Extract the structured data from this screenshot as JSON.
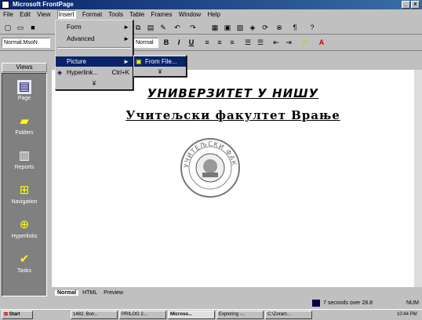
{
  "window": {
    "title": "Microsoft FrontPage"
  },
  "menu": [
    "File",
    "Edit",
    "View",
    "Insert",
    "Format",
    "Tools",
    "Table",
    "Frames",
    "Window",
    "Help"
  ],
  "toolbar2": {
    "style": "Normal.MsoN",
    "font": "Normal"
  },
  "insert_menu": {
    "items": [
      {
        "label": "Form",
        "arrow": "►"
      },
      {
        "label": "Advanced",
        "arrow": "►"
      },
      {
        "label": "Picture",
        "arrow": "►"
      },
      {
        "label": "Hyperlink...",
        "shortcut": "Ctrl+K"
      },
      {
        "label": "¥"
      }
    ]
  },
  "picture_submenu": {
    "items": [
      {
        "label": "From File..."
      },
      {
        "label": "¥"
      }
    ]
  },
  "views": {
    "title": "Views",
    "items": [
      "Page",
      "Folders",
      "Reports",
      "Navigation",
      "Hyperlinks",
      "Tasks"
    ]
  },
  "page": {
    "heading1": "УНИВЕРЗИТЕТ У НИШУ",
    "heading2": "Учитељски факултет Врање",
    "seal": "УЧИТЕЉСКИ ФАКУЛТЕТ"
  },
  "tabs": [
    "Normal",
    "HTML",
    "Preview"
  ],
  "status": {
    "time": "7 seconds over 28.8",
    "mode": "NUM"
  },
  "taskbar": {
    "start": "Start",
    "tasks": [
      "1482. Bon...",
      "PRILOG 2...",
      "Microso...",
      "Exploring -...",
      "C:\\Zoran\\..."
    ],
    "clock": "10:44 PM"
  }
}
